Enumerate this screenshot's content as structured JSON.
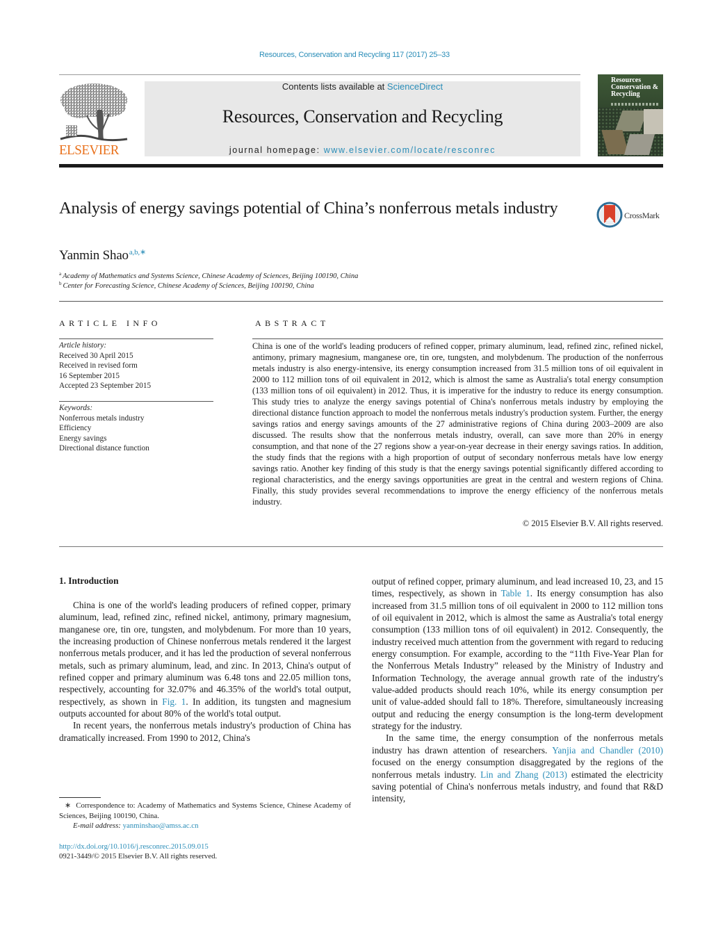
{
  "header": {
    "citation": "Resources, Conservation and Recycling 117 (2017) 25–33",
    "contents_prefix": "Contents lists available at ",
    "contents_link": "ScienceDirect",
    "journal_title": "Resources, Conservation and Recycling",
    "homepage_prefix": "journal homepage: ",
    "homepage_url": "www.elsevier.com/locate/resconrec",
    "publisher_logo_text": "ELSEVIER",
    "cover_title": "Resources Conservation & Recycling"
  },
  "article": {
    "title": "Analysis of energy savings potential of China’s nonferrous metals industry",
    "crossmark_label": "CrossMark",
    "author": "Yanmin Shao",
    "author_markers": "a,b,∗",
    "affiliations": [
      {
        "marker": "a",
        "text": "Academy of Mathematics and Systems Science, Chinese Academy of Sciences, Beijing 100190, China"
      },
      {
        "marker": "b",
        "text": "Center for Forecasting Science, Chinese Academy of Sciences, Beijing 100190, China"
      }
    ]
  },
  "article_info": {
    "label": "ARTICLE INFO",
    "history_heading": "Article history:",
    "history": [
      "Received 30 April 2015",
      "Received in revised form",
      "16 September 2015",
      "Accepted 23 September 2015"
    ],
    "keywords_heading": "Keywords:",
    "keywords": [
      "Nonferrous metals industry",
      "Efficiency",
      "Energy savings",
      "Directional distance function"
    ]
  },
  "abstract": {
    "label": "ABSTRACT",
    "text": "China is one of the world's leading producers of refined copper, primary aluminum, lead, refined zinc, refined nickel, antimony, primary magnesium, manganese ore, tin ore, tungsten, and molybdenum. The production of the nonferrous metals industry is also energy-intensive, its energy consumption increased from 31.5 million tons of oil equivalent in 2000 to 112 million tons of oil equivalent in 2012, which is almost the same as Australia's total energy consumption (133 million tons of oil equivalent) in 2012. Thus, it is imperative for the industry to reduce its energy consumption. This study tries to analyze the energy savings potential of China's nonferrous metals industry by employing the directional distance function approach to model the nonferrous metals industry's production system. Further, the energy savings ratios and energy savings amounts of the 27 administrative regions of China during 2003–2009 are also discussed. The results show that the nonferrous metals industry, overall, can save more than 20% in energy consumption, and that none of the 27 regions show a year-on-year decrease in their energy savings ratios. In addition, the study finds that the regions with a high proportion of output of secondary nonferrous metals have low energy savings ratio. Another key finding of this study is that the energy savings potential significantly differed according to regional characteristics, and the energy savings opportunities are great in the central and western regions of China. Finally, this study provides several recommendations to improve the energy efficiency of the nonferrous metals industry.",
    "copyright": "© 2015 Elsevier B.V. All rights reserved."
  },
  "body": {
    "section_heading": "1.  Introduction",
    "left_p1_a": "China is one of the world's leading producers of refined copper, primary aluminum, lead, refined zinc, refined nickel, antimony, primary magnesium, manganese ore, tin ore, tungsten, and molybdenum. For more than 10 years, the increasing production of Chinese nonferrous metals rendered it the largest nonferrous metals producer, and it has led the production of several nonferrous metals, such as primary aluminum, lead, and zinc. In 2013, China's output of refined copper and primary aluminum was 6.48 tons and 22.05 million tons, respectively, accounting for 32.07% and 46.35% of the world's total output, respectively, as shown in ",
    "left_p1_link": "Fig. 1",
    "left_p1_b": ". In addition, its tungsten and magnesium outputs accounted for about 80% of the world's total output.",
    "left_p2": "In recent years, the nonferrous metals industry's production of China has dramatically increased. From 1990 to 2012, China's",
    "right_p1_a": "output of refined copper, primary aluminum, and lead increased 10, 23, and 15 times, respectively, as shown in ",
    "right_p1_link": "Table 1",
    "right_p1_b": ". Its energy consumption has also increased from 31.5 million tons of oil equivalent in 2000 to 112 million tons of oil equivalent in 2012, which is almost the same as Australia's total energy consumption (133 million tons of oil equivalent) in 2012. Consequently, the industry received much attention from the government with regard to reducing energy consumption. For example, according to the “11th Five-Year Plan for the Nonferrous Metals Industry” released by the Ministry of Industry and Information Technology, the average annual growth rate of the industry's value-added products should reach 10%, while its energy consumption per unit of value-added should fall to 18%. Therefore, simultaneously increasing output and reducing the energy consumption is the long-term development strategy for the industry.",
    "right_p2_a": "In the same time, the energy consumption of the nonferrous metals industry has drawn attention of researchers. ",
    "right_p2_link1": "Yanjia and Chandler (2010)",
    "right_p2_b": " focused on the energy consumption disaggregated by the regions of the nonferrous metals industry. ",
    "right_p2_link2": "Lin and Zhang (2013)",
    "right_p2_c": " estimated the electricity saving potential of China's nonferrous metals industry, and found that R&D intensity,"
  },
  "footnote": {
    "marker": "∗",
    "correspondence": "Correspondence to: Academy of Mathematics and Systems Science, Chinese Academy of Sciences, Beijing 100190, China.",
    "email_label": "E-mail address:",
    "email": "yanminshao@amss.ac.cn",
    "doi": "http://dx.doi.org/10.1016/j.resconrec.2015.09.015",
    "issn": "0921-3449/© 2015 Elsevier B.V. All rights reserved."
  },
  "colors": {
    "link": "#2a8db8",
    "elsevier_orange": "#e9711c",
    "band_gray": "#e8e8e8",
    "crossmark_red": "#d9412b",
    "crossmark_blue": "#2f6f98"
  }
}
